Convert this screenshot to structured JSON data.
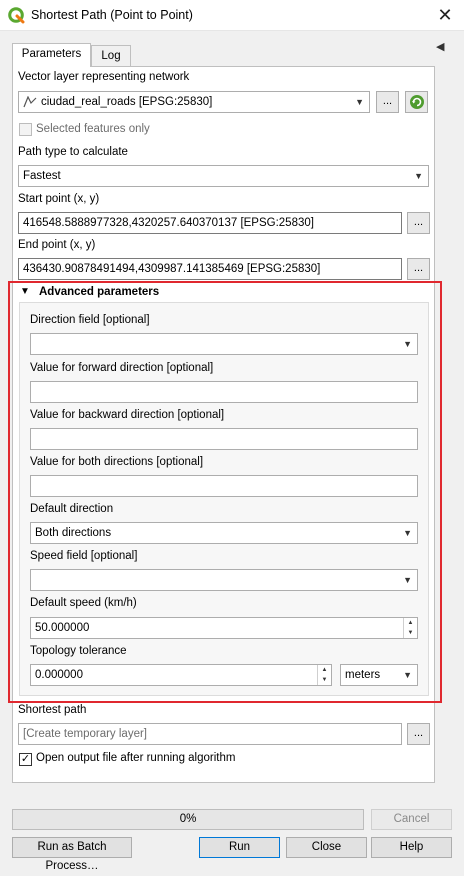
{
  "window": {
    "title": "Shortest Path (Point to Point)",
    "close_glyph": "✕"
  },
  "tabs": [
    {
      "label": "Parameters"
    },
    {
      "label": "Log"
    }
  ],
  "form": {
    "network_label": "Vector layer representing network",
    "network_value": "ciudad_real_roads [EPSG:25830]",
    "selected_features_label": "Selected features only",
    "path_type_label": "Path type to calculate",
    "path_type_value": "Fastest",
    "start_label": "Start point (x, y)",
    "start_value": "416548.5888977328,4320257.640370137 [EPSG:25830]",
    "end_label": "End point (x, y)",
    "end_value": "436430.90878491494,4309987.141385469 [EPSG:25830]",
    "ellipsis": "..."
  },
  "advanced": {
    "header": "Advanced parameters",
    "direction_field_label": "Direction field [optional]",
    "direction_field_value": "",
    "forward_label": "Value for forward direction [optional]",
    "forward_value": "",
    "backward_label": "Value for backward direction [optional]",
    "backward_value": "",
    "both_label": "Value for both directions [optional]",
    "both_value": "",
    "default_direction_label": "Default direction",
    "default_direction_value": "Both directions",
    "speed_field_label": "Speed field [optional]",
    "speed_field_value": "",
    "default_speed_label": "Default speed (km/h)",
    "default_speed_value": "50.000000",
    "tolerance_label": "Topology tolerance",
    "tolerance_value": "0.000000",
    "tolerance_unit": "meters"
  },
  "output": {
    "label": "Shortest path",
    "placeholder": "[Create temporary layer]",
    "open_label": "Open output file after running algorithm"
  },
  "progress": {
    "text": "0%",
    "value": 0
  },
  "buttons": {
    "cancel": "Cancel",
    "batch": "Run as Batch Process…",
    "run": "Run",
    "close": "Close",
    "help": "Help"
  },
  "colors": {
    "highlight": "#e0282f",
    "qgis_green": "#5aa830"
  },
  "icons": {
    "app": "qgis-logo-icon",
    "line_layer": "line-layer-icon",
    "iterate": "iterate-icon",
    "dropdown": "chevron-down-icon",
    "collapse": "triangle-down-icon"
  }
}
